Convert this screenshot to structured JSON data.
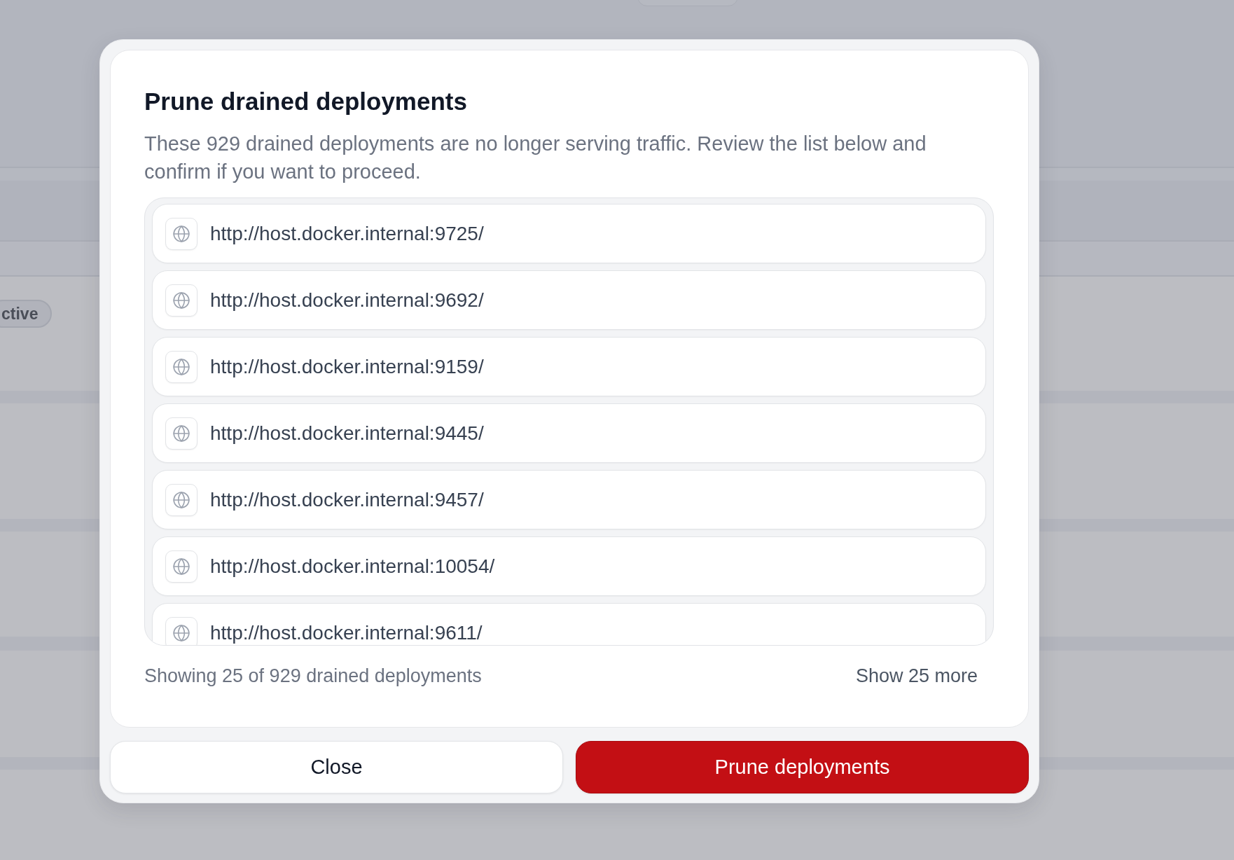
{
  "background": {
    "status_badge": "ctive"
  },
  "dialog": {
    "title": "Prune drained deployments",
    "description": "These 929 drained deployments are no longer serving traffic. Review the list below and confirm if you want to proceed.",
    "deployments": [
      {
        "url": "http://host.docker.internal:9725/"
      },
      {
        "url": "http://host.docker.internal:9692/"
      },
      {
        "url": "http://host.docker.internal:9159/"
      },
      {
        "url": "http://host.docker.internal:9445/"
      },
      {
        "url": "http://host.docker.internal:9457/"
      },
      {
        "url": "http://host.docker.internal:10054/"
      },
      {
        "url": "http://host.docker.internal:9611/"
      }
    ],
    "summary": "Showing 25 of 929 drained deployments",
    "show_more": "Show 25 more",
    "buttons": [
      {
        "label": "Close",
        "kind": "secondary"
      },
      {
        "label": "Prune deployments",
        "kind": "danger"
      }
    ]
  }
}
